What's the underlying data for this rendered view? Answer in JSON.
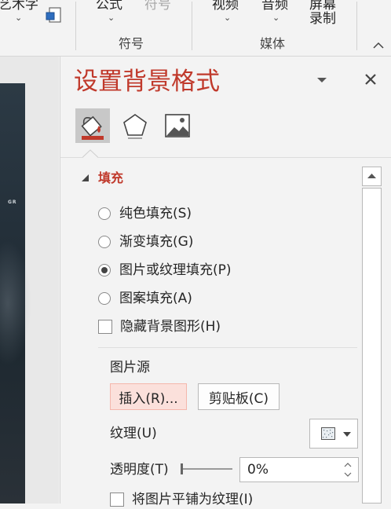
{
  "ribbon": {
    "wordart_label": "艺术字",
    "formula_label": "公式",
    "symbol_label": "符号",
    "video_label": "视频",
    "audio_label": "音频",
    "screen_rec_line1": "屏幕",
    "screen_rec_line2": "录制",
    "group_symbols": "符号",
    "group_media": "媒体"
  },
  "slide": {
    "text": "GR"
  },
  "pane": {
    "title": "设置背景格式",
    "tabs": [
      "fill",
      "effects",
      "picture"
    ],
    "active_tab": "fill",
    "section_fill": "填充",
    "options": [
      {
        "label": "纯色填充(S)",
        "type": "radio",
        "selected": false
      },
      {
        "label": "渐变填充(G)",
        "type": "radio",
        "selected": false
      },
      {
        "label": "图片或纹理填充(P)",
        "type": "radio",
        "selected": true
      },
      {
        "label": "图案填充(A)",
        "type": "radio",
        "selected": false
      },
      {
        "label": "隐藏背景图形(H)",
        "type": "checkbox",
        "checked": false
      }
    ],
    "picture_source_label": "图片源",
    "insert_button": "插入(R)...",
    "clipboard_button": "剪贴板(C)",
    "texture_label": "纹理(U)",
    "transparency_label": "透明度(T)",
    "transparency_value": "0%",
    "transparency_fraction": 0,
    "tile_label": "将图片平铺为纹理(I)",
    "tile_checked": false
  },
  "colors": {
    "accent": "#c0392b",
    "insert_button_bg": "#fbe0db",
    "pane_bg": "#f3f3f3"
  }
}
